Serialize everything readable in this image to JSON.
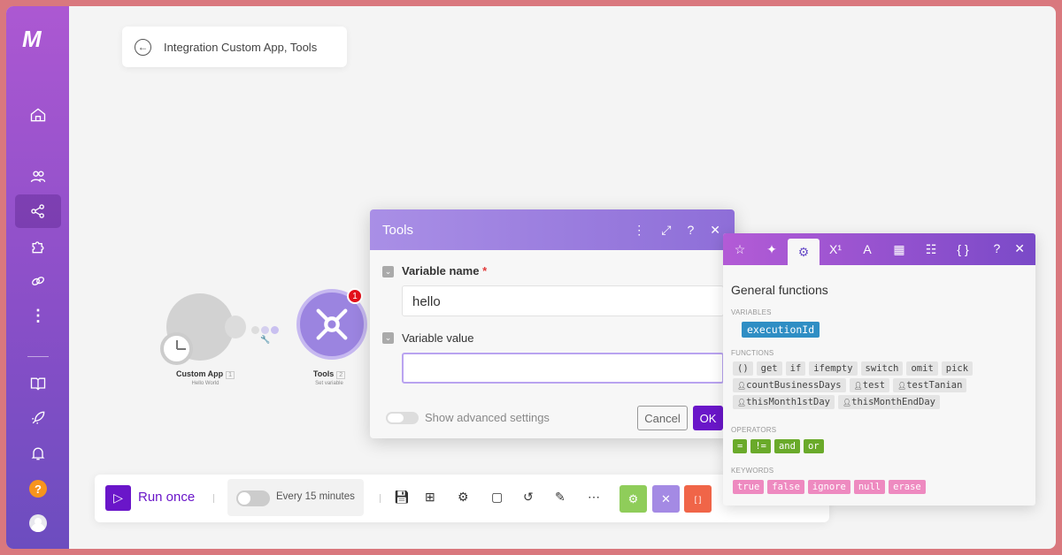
{
  "app": {
    "logo": "M"
  },
  "breadcrumb": {
    "title": "Integration Custom App, Tools"
  },
  "nodes": [
    {
      "title": "Custom App",
      "num": "1",
      "sub": "Hello World"
    },
    {
      "title": "Tools",
      "num": "2",
      "sub": "Set variable",
      "badge": "1"
    }
  ],
  "modal": {
    "title": "Tools",
    "field1": {
      "label": "Variable name",
      "required": "*",
      "value": "hello"
    },
    "field2": {
      "label": "Variable value",
      "value": ""
    },
    "advanced": "Show advanced settings",
    "cancel": "Cancel",
    "ok": "OK"
  },
  "panel": {
    "heading": "General functions",
    "tabs": [
      "star",
      "sparkle",
      "gear",
      "superscript",
      "text",
      "calendar",
      "table",
      "braces"
    ],
    "tab_glyphs": {
      "superscript": "X¹",
      "text": "A",
      "braces": "{ }"
    },
    "variables_label": "VARIABLES",
    "variables": [
      "executionId"
    ],
    "functions_label": "FUNCTIONS",
    "functions": [
      "()",
      "get",
      "if",
      "ifempty",
      "switch",
      "omit",
      "pick"
    ],
    "custom_functions": [
      "countBusinessDays",
      "test",
      "testTanian",
      "thisMonth1stDay",
      "thisMonthEndDay"
    ],
    "operators_label": "OPERATORS",
    "operators": [
      "=",
      "!=",
      "and",
      "or"
    ],
    "keywords_label": "KEYWORDS",
    "keywords": [
      "true",
      "false",
      "ignore",
      "null",
      "erase"
    ]
  },
  "toolbar": {
    "run": "Run once",
    "schedule": "Every 15 minutes"
  },
  "colors": {
    "accent": "#6a16c9",
    "variable": "#2f8ec4",
    "operator": "#6aaa2a",
    "keyword": "#ee8ac0"
  }
}
